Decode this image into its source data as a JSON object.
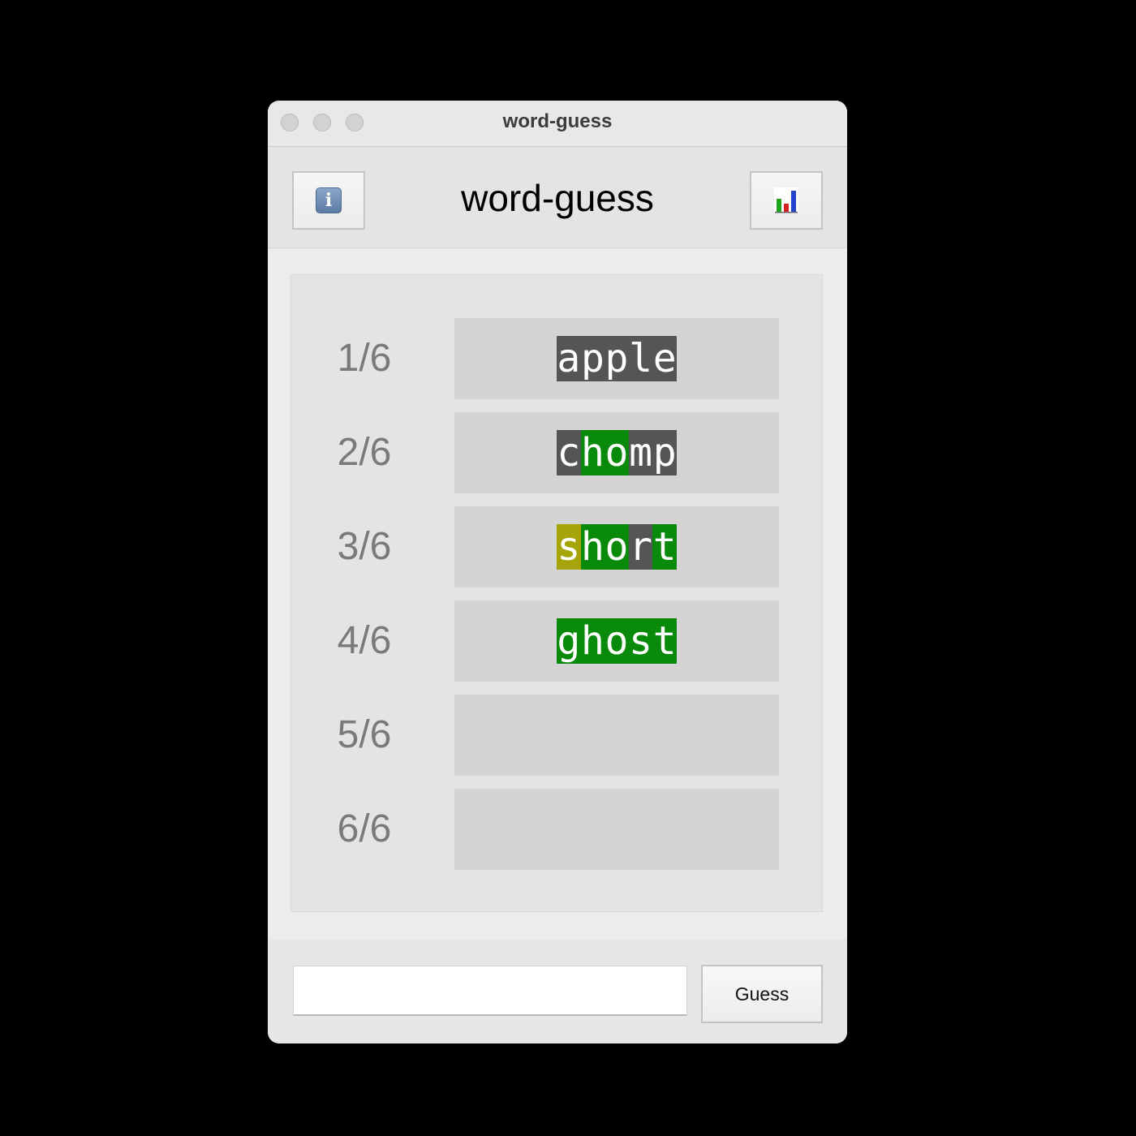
{
  "window": {
    "title": "word-guess"
  },
  "header": {
    "title": "word-guess",
    "info_icon": "info-icon",
    "stats_icon": "bar-chart-icon"
  },
  "colors": {
    "absent": "#555555",
    "present": "#a5a50a",
    "correct": "#0a8a0a"
  },
  "board": {
    "rows": [
      {
        "label": "1/6",
        "letters": [
          {
            "ch": "a",
            "state": "absent"
          },
          {
            "ch": "p",
            "state": "absent"
          },
          {
            "ch": "p",
            "state": "absent"
          },
          {
            "ch": "l",
            "state": "absent"
          },
          {
            "ch": "e",
            "state": "absent"
          }
        ]
      },
      {
        "label": "2/6",
        "letters": [
          {
            "ch": "c",
            "state": "absent"
          },
          {
            "ch": "h",
            "state": "correct"
          },
          {
            "ch": "o",
            "state": "correct"
          },
          {
            "ch": "m",
            "state": "absent"
          },
          {
            "ch": "p",
            "state": "absent"
          }
        ]
      },
      {
        "label": "3/6",
        "letters": [
          {
            "ch": "s",
            "state": "present"
          },
          {
            "ch": "h",
            "state": "correct"
          },
          {
            "ch": "o",
            "state": "correct"
          },
          {
            "ch": "r",
            "state": "absent"
          },
          {
            "ch": "t",
            "state": "correct"
          }
        ]
      },
      {
        "label": "4/6",
        "letters": [
          {
            "ch": "g",
            "state": "correct"
          },
          {
            "ch": "h",
            "state": "correct"
          },
          {
            "ch": "o",
            "state": "correct"
          },
          {
            "ch": "s",
            "state": "correct"
          },
          {
            "ch": "t",
            "state": "correct"
          }
        ]
      },
      {
        "label": "5/6",
        "letters": []
      },
      {
        "label": "6/6",
        "letters": []
      }
    ]
  },
  "footer": {
    "input_value": "",
    "guess_label": "Guess"
  }
}
